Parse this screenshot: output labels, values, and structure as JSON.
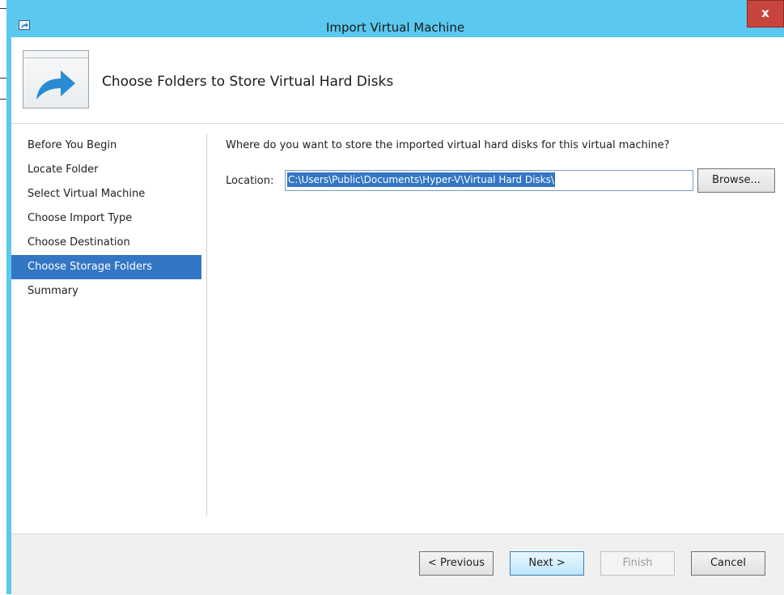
{
  "window": {
    "title": "Import Virtual Machine",
    "close_label": "x"
  },
  "banner": {
    "title": "Choose Folders to Store Virtual Hard Disks"
  },
  "nav": {
    "items": [
      {
        "label": "Before You Begin",
        "selected": false
      },
      {
        "label": "Locate Folder",
        "selected": false
      },
      {
        "label": "Select Virtual Machine",
        "selected": false
      },
      {
        "label": "Choose Import Type",
        "selected": false
      },
      {
        "label": "Choose Destination",
        "selected": false
      },
      {
        "label": "Choose Storage Folders",
        "selected": true
      },
      {
        "label": "Summary",
        "selected": false
      }
    ]
  },
  "content": {
    "question": "Where do you want to store the imported virtual hard disks for this virtual machine?",
    "location_label": "Location:",
    "location_value": "C:\\Users\\Public\\Documents\\Hyper-V\\Virtual Hard Disks\\",
    "browse_label": "Browse..."
  },
  "footer": {
    "previous_label": "< Previous",
    "next_label": "Next >",
    "finish_label": "Finish",
    "cancel_label": "Cancel"
  },
  "colors": {
    "title_bar": "#5ac8ef",
    "selection": "#3376c4",
    "close_button": "#c7453b"
  }
}
